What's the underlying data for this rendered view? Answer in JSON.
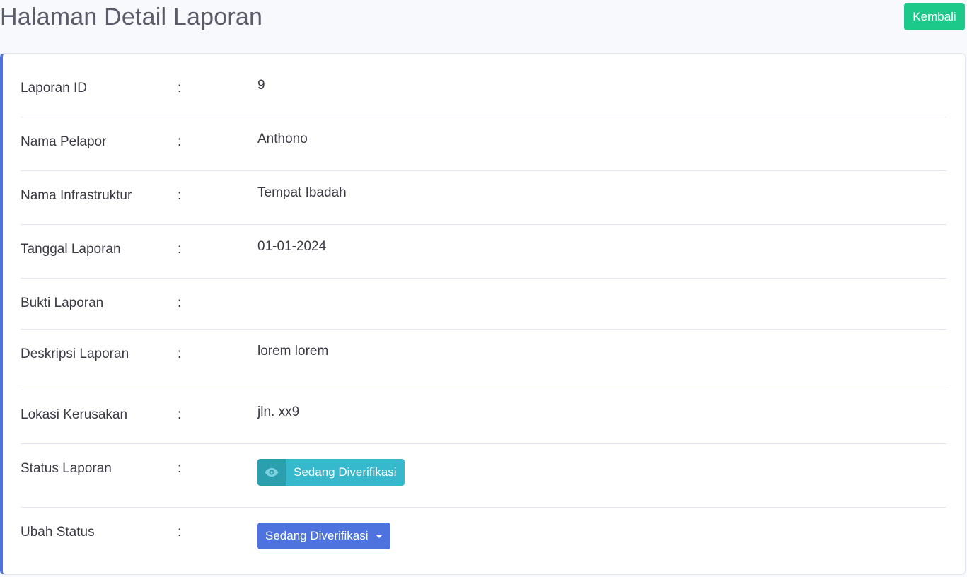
{
  "header": {
    "title": "Halaman Detail Laporan",
    "back_label": "Kembali"
  },
  "details": {
    "report_id": {
      "label": "Laporan ID",
      "colon": ":",
      "value": "9"
    },
    "reporter_name": {
      "label": "Nama Pelapor",
      "colon": ":",
      "value": "Anthono"
    },
    "infrastructure_name": {
      "label": "Nama Infrastruktur",
      "colon": ":",
      "value": "Tempat Ibadah"
    },
    "report_date": {
      "label": "Tanggal Laporan",
      "colon": ":",
      "value": "01-01-2024"
    },
    "evidence": {
      "label": "Bukti Laporan",
      "colon": ":",
      "value": ""
    },
    "description": {
      "label": "Deskripsi Laporan",
      "colon": ":",
      "value": "lorem lorem"
    },
    "location": {
      "label": "Lokasi Kerusakan",
      "colon": ":",
      "value": "jln. xx9"
    },
    "status": {
      "label": "Status Laporan",
      "colon": ":",
      "value": "Sedang Diverifikasi",
      "icon": "eye-icon"
    },
    "change_status": {
      "label": "Ubah Status",
      "colon": ":",
      "selected": "Sedang Diverifikasi"
    }
  },
  "colors": {
    "accent": "#4e73df",
    "success": "#1cc88a",
    "info": "#36b9cc",
    "info_dark": "#2c9faf"
  }
}
